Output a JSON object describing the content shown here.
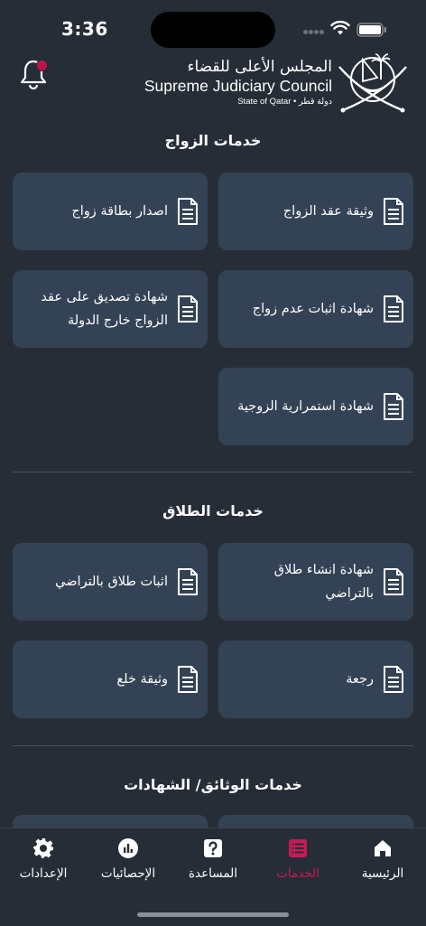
{
  "status_bar": {
    "time": "3:36"
  },
  "header": {
    "logo_ar": "المجلس الأعلى للقضاء",
    "logo_en": "Supreme Judiciary Council",
    "logo_state": "State of Qatar • دولة قطر"
  },
  "sections": {
    "marriage": {
      "title": "خدمات الزواج",
      "cards": [
        "وثيقة عقد الزواج",
        "اصدار بطاقة زواج",
        "شهادة اثبات عدم زواج",
        "شهادة تصديق على عقد الزواج خارج الدولة",
        "شهادة استمرارية الزوجية"
      ]
    },
    "divorce": {
      "title": "خدمات الطلاق",
      "cards": [
        "شهادة انشاء طلاق بالتراضي",
        "اثبات طلاق بالتراضي",
        "رجعة",
        "وثيقة خلع"
      ]
    },
    "documents": {
      "title": "خدمات الوثائق/ الشهادات"
    }
  },
  "tabs": {
    "home": "الرئيسية",
    "services": "الخدمات",
    "help": "المساعدة",
    "stats": "الإحصائيات",
    "settings": "الإعدادات"
  },
  "colors": {
    "background": "#262d36",
    "card": "#344255",
    "accent": "#c81a54"
  }
}
